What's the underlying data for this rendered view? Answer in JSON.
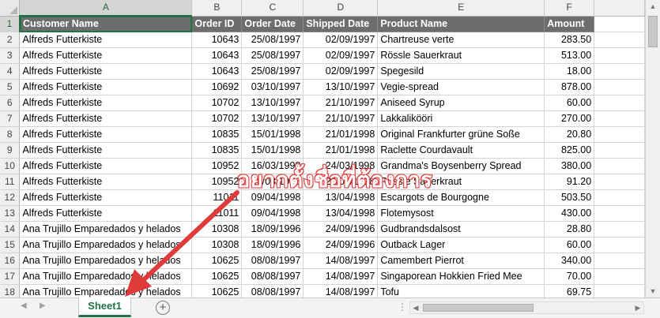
{
  "sheet": {
    "columns": [
      "A",
      "B",
      "C",
      "D",
      "E",
      "F"
    ],
    "active_column": "A",
    "active_row": 1,
    "header_row": [
      "Customer Name",
      "Order ID",
      "Order Date",
      "Shipped Date",
      "Product Name",
      "Amount"
    ],
    "rows": [
      {
        "num": "2",
        "cells": [
          "Alfreds Futterkiste",
          "10643",
          "25/08/1997",
          "02/09/1997",
          "Chartreuse verte",
          "283.50"
        ]
      },
      {
        "num": "3",
        "cells": [
          "Alfreds Futterkiste",
          "10643",
          "25/08/1997",
          "02/09/1997",
          "Rössle Sauerkraut",
          "513.00"
        ]
      },
      {
        "num": "4",
        "cells": [
          "Alfreds Futterkiste",
          "10643",
          "25/08/1997",
          "02/09/1997",
          "Spegesild",
          "18.00"
        ]
      },
      {
        "num": "5",
        "cells": [
          "Alfreds Futterkiste",
          "10692",
          "03/10/1997",
          "13/10/1997",
          "Vegie-spread",
          "878.00"
        ]
      },
      {
        "num": "6",
        "cells": [
          "Alfreds Futterkiste",
          "10702",
          "13/10/1997",
          "21/10/1997",
          "Aniseed Syrup",
          "60.00"
        ]
      },
      {
        "num": "7",
        "cells": [
          "Alfreds Futterkiste",
          "10702",
          "13/10/1997",
          "21/10/1997",
          "Lakkalikööri",
          "270.00"
        ]
      },
      {
        "num": "8",
        "cells": [
          "Alfreds Futterkiste",
          "10835",
          "15/01/1998",
          "21/01/1998",
          "Original Frankfurter grüne Soße",
          "20.80"
        ]
      },
      {
        "num": "9",
        "cells": [
          "Alfreds Futterkiste",
          "10835",
          "15/01/1998",
          "21/01/1998",
          "Raclette Courdavault",
          "825.00"
        ]
      },
      {
        "num": "10",
        "cells": [
          "Alfreds Futterkiste",
          "10952",
          "16/03/1998",
          "24/03/1998",
          "Grandma's Boysenberry Spread",
          "380.00"
        ]
      },
      {
        "num": "11",
        "cells": [
          "Alfreds Futterkiste",
          "10952",
          "16/03/1998",
          "24/03/1998",
          "Rössle Sauerkraut",
          "91.20"
        ]
      },
      {
        "num": "12",
        "cells": [
          "Alfreds Futterkiste",
          "11011",
          "09/04/1998",
          "13/04/1998",
          "Escargots de Bourgogne",
          "503.50"
        ]
      },
      {
        "num": "13",
        "cells": [
          "Alfreds Futterkiste",
          "11011",
          "09/04/1998",
          "13/04/1998",
          "Flotemysost",
          "430.00"
        ]
      },
      {
        "num": "14",
        "cells": [
          "Ana Trujillo Emparedados y helados",
          "10308",
          "18/09/1996",
          "24/09/1996",
          "Gudbrandsdalsost",
          "28.80"
        ]
      },
      {
        "num": "15",
        "cells": [
          "Ana Trujillo Emparedados y helados",
          "10308",
          "18/09/1996",
          "24/09/1996",
          "Outback Lager",
          "60.00"
        ]
      },
      {
        "num": "16",
        "cells": [
          "Ana Trujillo Emparedados y helados",
          "10625",
          "08/08/1997",
          "14/08/1997",
          "Camembert Pierrot",
          "340.00"
        ]
      },
      {
        "num": "17",
        "cells": [
          "Ana Trujillo Emparedados y helados",
          "10625",
          "08/08/1997",
          "14/08/1997",
          "Singaporean Hokkien Fried Mee",
          "70.00"
        ]
      },
      {
        "num": "18",
        "cells": [
          "Ana Trujillo Emparedados y helados",
          "10625",
          "08/08/1997",
          "14/08/1997",
          "Tofu",
          "69.75"
        ]
      }
    ]
  },
  "tabs": {
    "sheets": [
      "Sheet1"
    ],
    "active": "Sheet1",
    "add_label": "+",
    "options_label": "⋮"
  },
  "annotation": {
    "text": "อยากตั้งชื่อที่ต้องการ",
    "color": "#e03b3b"
  },
  "colors": {
    "accent": "#217346",
    "header_fill": "#6d6d6d"
  }
}
